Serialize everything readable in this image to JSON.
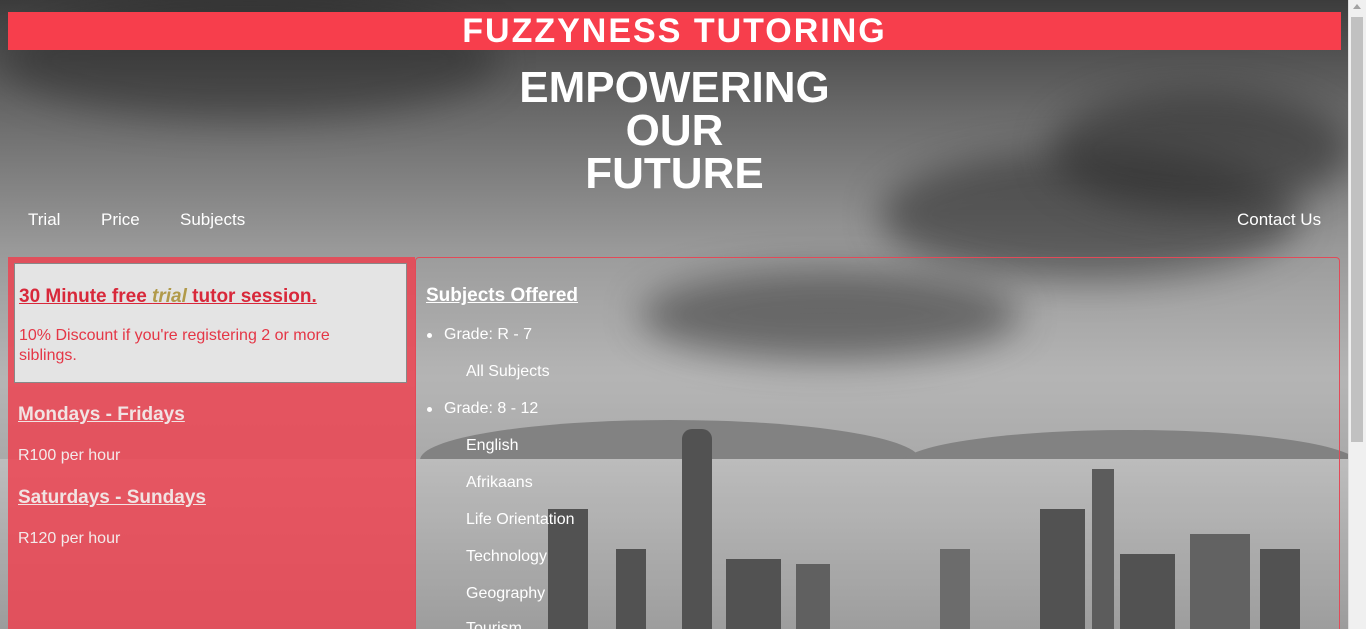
{
  "header": {
    "title": "FUZZYNESS TUTORING"
  },
  "hero": {
    "line1": "EMPOWERING",
    "line2": "OUR",
    "line3": "FUTURE"
  },
  "nav": {
    "trial": "Trial",
    "price": "Price",
    "subjects": "Subjects",
    "contact": "Contact Us"
  },
  "pricing": {
    "trial_heading_before": "30 Minute free ",
    "trial_heading_word": "trial",
    "trial_heading_after": " tutor session.",
    "discount": "10% Discount if you're registering 2 or more siblings.",
    "weekdays_heading": "Mondays - Fridays",
    "weekdays_price": "R100 per hour",
    "weekend_heading": "Saturdays - Sundays",
    "weekend_price": "R120 per hour"
  },
  "subjects": {
    "title": "Subjects Offered",
    "groups": [
      {
        "grade": "Grade: R - 7",
        "items": [
          "All Subjects"
        ]
      },
      {
        "grade": "Grade: 8 - 12",
        "items": [
          "English",
          "Afrikaans",
          "Life Orientation",
          "Technology",
          "Geography",
          "Tourism"
        ]
      }
    ]
  },
  "colors": {
    "brand_red": "#f73e4c",
    "panel_red": "#ef3f4e",
    "trial_gold": "#b19a4a"
  }
}
